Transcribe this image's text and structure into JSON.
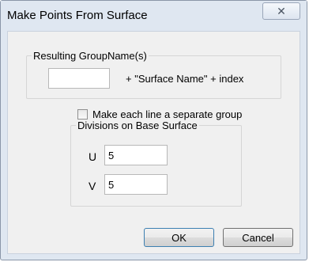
{
  "window": {
    "title": "Make Points From Surface"
  },
  "result_group": {
    "legend": "Resulting GroupName(s)",
    "input_value": "",
    "suffix": "+ \"Surface Name\" + index"
  },
  "options": {
    "separate_group_label": "Make each line a separate group",
    "separate_group_checked": false
  },
  "divisions": {
    "legend": "Divisions on Base Surface",
    "u_label": "U",
    "u_value": "5",
    "v_label": "V",
    "v_value": "5"
  },
  "buttons": {
    "ok": "OK",
    "cancel": "Cancel"
  },
  "icons": {
    "close": "close-icon"
  }
}
